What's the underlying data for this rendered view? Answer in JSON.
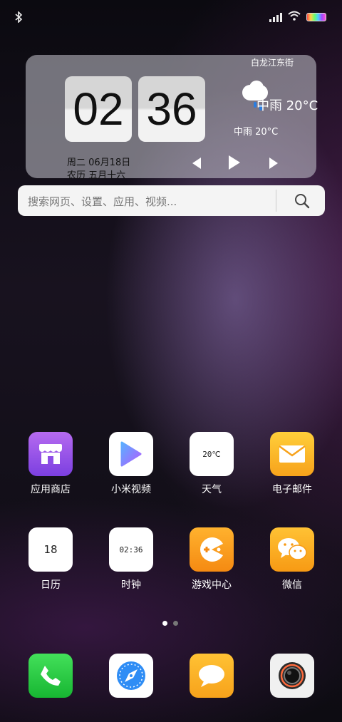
{
  "status": {
    "bluetooth_icon": "bluetooth-icon",
    "signal_icon": "signal-bars-icon",
    "wifi_icon": "wifi-icon",
    "battery_icon": "battery-icon"
  },
  "widget": {
    "location": "白龙江东街",
    "hour": "02",
    "minute": "36",
    "weather_big": "中雨  20°C",
    "weather_small": "中雨  20°C",
    "date": "周二 06月18日",
    "lunar": "农历 五月十六"
  },
  "search": {
    "placeholder": "搜索网页、设置、应用、视频..."
  },
  "apps": [
    {
      "label": "应用商店",
      "icon": "store-icon"
    },
    {
      "label": "小米视频",
      "icon": "play-icon"
    },
    {
      "label": "天气",
      "icon": "weather-app-icon",
      "icon_text": "20℃"
    },
    {
      "label": "电子邮件",
      "icon": "mail-icon"
    },
    {
      "label": "日历",
      "icon": "calendar-icon",
      "icon_text": "18"
    },
    {
      "label": "时钟",
      "icon": "clock-icon",
      "icon_text": "02:36"
    },
    {
      "label": "游戏中心",
      "icon": "game-center-icon"
    },
    {
      "label": "微信",
      "icon": "wechat-icon"
    }
  ],
  "dock": [
    {
      "icon": "phone-icon"
    },
    {
      "icon": "browser-compass-icon"
    },
    {
      "icon": "messages-icon"
    },
    {
      "icon": "camera-icon"
    }
  ],
  "pages": {
    "count": 2,
    "current": 1
  }
}
